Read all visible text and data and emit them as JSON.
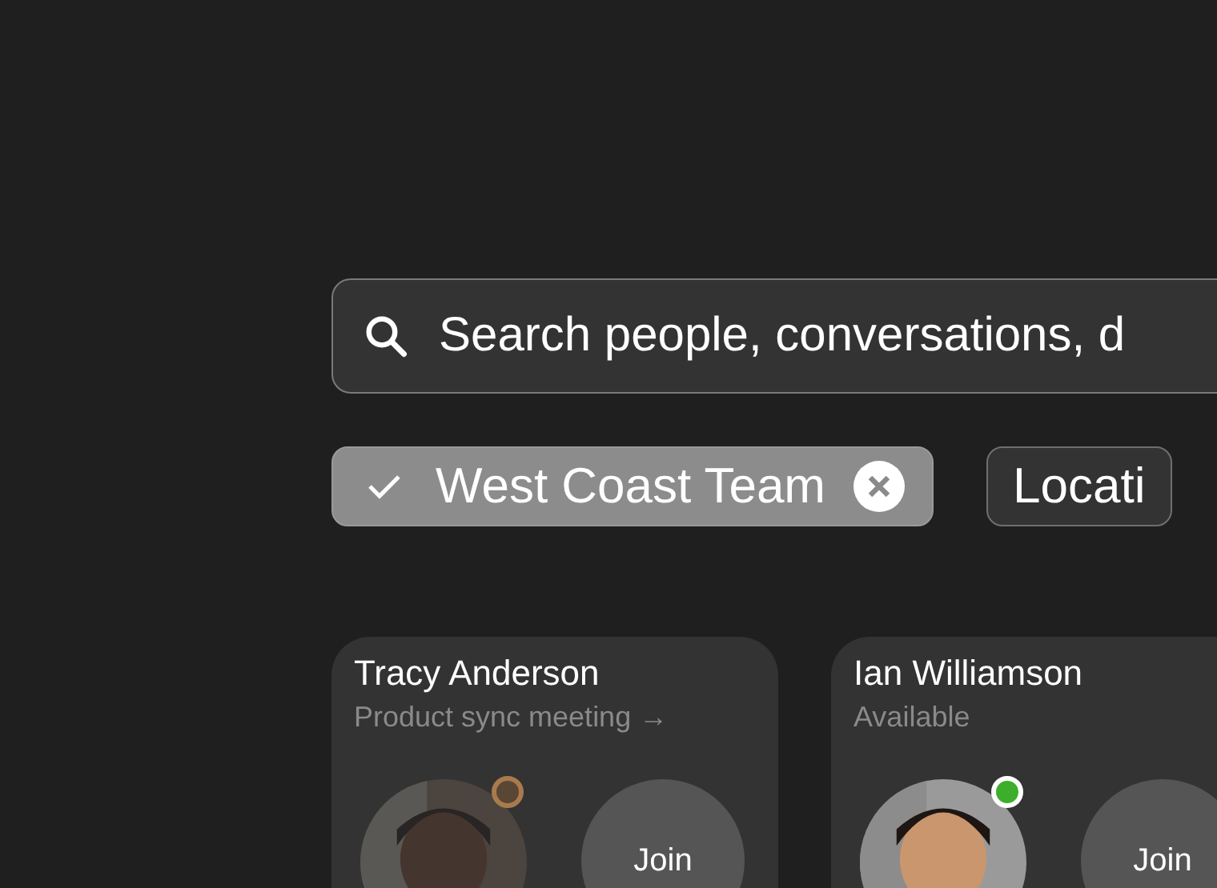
{
  "search": {
    "placeholder": "Search people, conversations, d"
  },
  "filters": [
    {
      "label": "West Coast Team",
      "selected": true
    },
    {
      "label": "Locati",
      "selected": false
    }
  ],
  "people": [
    {
      "name": "Tracy Anderson",
      "status": "Product sync meeting →",
      "color": "#a97a4d",
      "dimmed": true,
      "action": "Join"
    },
    {
      "name": "Ian Williamson",
      "status": "Available",
      "color": "#3dae2b",
      "dimmed": false,
      "action": "Join"
    }
  ]
}
